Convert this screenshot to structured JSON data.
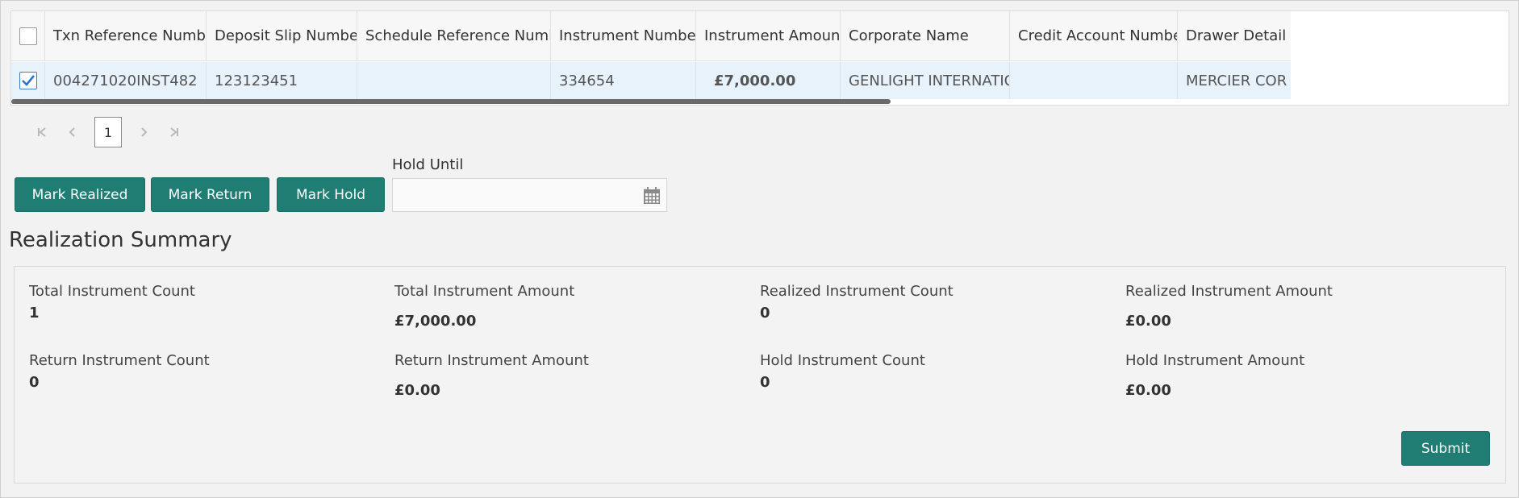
{
  "grid": {
    "columns": [
      "Txn Reference Number",
      "Deposit Slip Number",
      "Schedule Reference Number",
      "Instrument Number",
      "Instrument Amount",
      "Corporate Name",
      "Credit Account Number",
      "Drawer Detail"
    ],
    "rows": [
      {
        "selected": true,
        "txn_ref": "004271020INST482",
        "deposit_slip": "123123451",
        "schedule_ref": "",
        "instrument_no": "334654",
        "amount": "£7,000.00",
        "corporate": "GENLIGHT INTERNATIONAL",
        "credit_account": "",
        "drawer": "MERCIER COR"
      }
    ]
  },
  "pager": {
    "current_page": "1",
    "first": "K",
    "prev": "‹",
    "next": "›",
    "last": "K"
  },
  "actions": {
    "mark_realized": "Mark Realized",
    "mark_return": "Mark Return",
    "mark_hold": "Mark Hold",
    "hold_until_label": "Hold Until",
    "hold_until_value": ""
  },
  "summary": {
    "title": "Realization Summary",
    "metrics": [
      {
        "label": "Total Instrument Count",
        "value": "1"
      },
      {
        "label": "Total Instrument Amount",
        "value": "£7,000.00"
      },
      {
        "label": "Realized Instrument Count",
        "value": "0"
      },
      {
        "label": "Realized Instrument Amount",
        "value": "£0.00"
      },
      {
        "label": "Return Instrument Count",
        "value": "0"
      },
      {
        "label": "Return Instrument Amount",
        "value": "£0.00"
      },
      {
        "label": "Hold Instrument Count",
        "value": "0"
      },
      {
        "label": "Hold Instrument Amount",
        "value": "£0.00"
      }
    ],
    "submit": "Submit"
  },
  "colors": {
    "accent": "#1f7d74",
    "link": "#1f6eb5",
    "selected_row": "#e8f2fb"
  },
  "icons": [
    "checkbox-icon",
    "first-page-icon",
    "prev-page-icon",
    "next-page-icon",
    "last-page-icon",
    "calendar-icon"
  ]
}
